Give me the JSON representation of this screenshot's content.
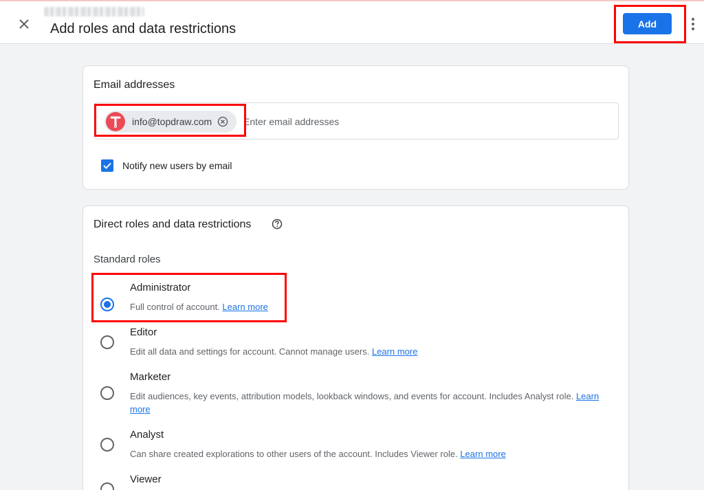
{
  "header": {
    "title": "Add roles and data restrictions",
    "add_label": "Add"
  },
  "email_section": {
    "title": "Email addresses",
    "chip": {
      "avatar_letter": "T",
      "email": "info@topdraw.com"
    },
    "input_placeholder": "Enter email addresses",
    "notify": {
      "label": "Notify new users by email",
      "checked": true
    }
  },
  "roles_section": {
    "title": "Direct roles and data restrictions",
    "subheading": "Standard roles",
    "link_text": "Learn more",
    "selected": "Administrator",
    "roles": [
      {
        "name": "Administrator",
        "description": "Full control of account."
      },
      {
        "name": "Editor",
        "description": "Edit all data and settings for account. Cannot manage users."
      },
      {
        "name": "Marketer",
        "description": "Edit audiences, key events, attribution models, lookback windows, and events for account. Includes Analyst role."
      },
      {
        "name": "Analyst",
        "description": "Can share created explorations to other users of the account. Includes Viewer role."
      },
      {
        "name": "Viewer",
        "description": ""
      }
    ]
  },
  "colors": {
    "accent": "#1a73e8",
    "highlight": "#ff0000",
    "avatar": "#ea4b57",
    "background": "#f1f3f4"
  },
  "icons": [
    "close-icon",
    "more-vert-icon",
    "remove-chip-icon",
    "checkmark-icon",
    "help-circle-icon",
    "avatar-t-icon"
  ]
}
